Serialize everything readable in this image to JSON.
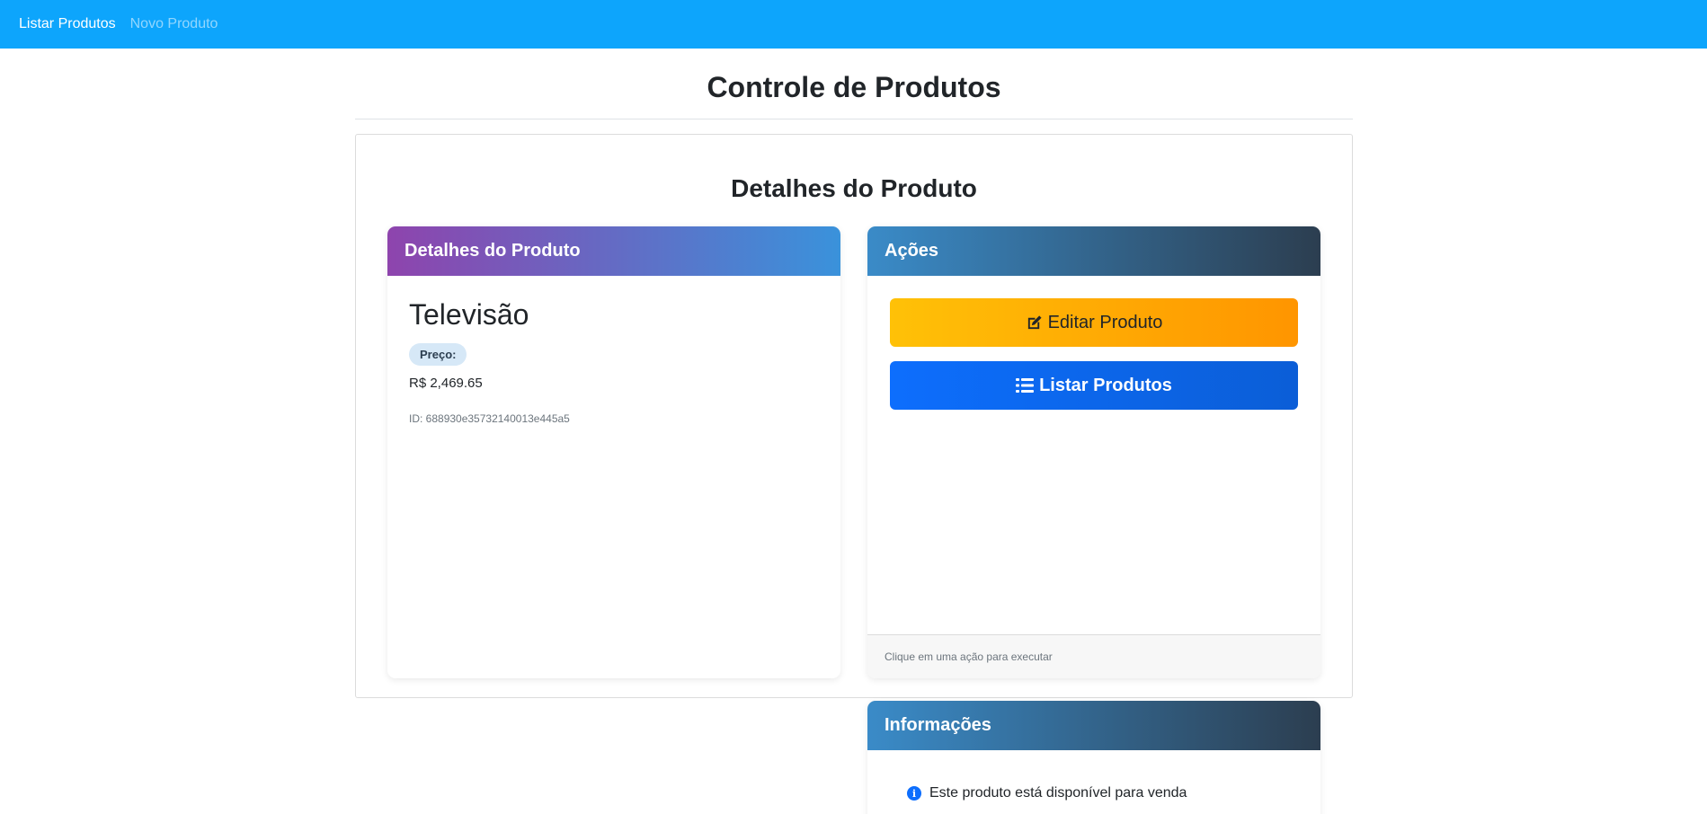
{
  "nav": {
    "items": [
      {
        "label": "Listar Produtos",
        "active": true
      },
      {
        "label": "Novo Produto",
        "active": false
      }
    ]
  },
  "page": {
    "title": "Controle de Produtos",
    "section_title": "Detalhes do Produto"
  },
  "details": {
    "header": "Detalhes do Produto",
    "product_name": "Televisão",
    "price_label": "Preço:",
    "price_value": "R$ 2,469.65",
    "id_text": "ID: 688930e35732140013e445a5"
  },
  "actions": {
    "header": "Ações",
    "edit_label": "Editar Produto",
    "list_label": "Listar Produtos",
    "footer_text": "Clique em uma ação para executar"
  },
  "info": {
    "header": "Informações",
    "message": "Este produto está disponível para venda"
  },
  "colors": {
    "navbar": "#0da5fc",
    "edit_button": "#ffc107",
    "list_button": "#0d6efd",
    "details_header_start": "#8e44ad",
    "details_header_end": "#3a92db",
    "actions_header_end": "#2c3e50"
  },
  "icons": {
    "edit": "edit-icon",
    "list": "list-icon",
    "info": "info-circle-icon"
  }
}
